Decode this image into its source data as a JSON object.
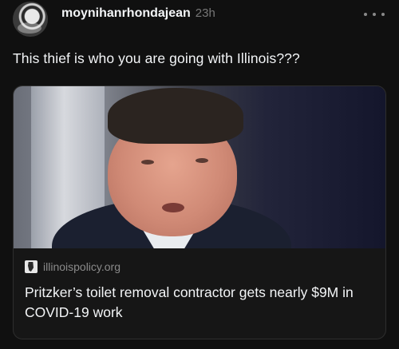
{
  "post": {
    "username": "moynihanrhondajean",
    "timestamp": "23h",
    "text": "This thief is who you are going with Illinois???",
    "more_icon": "more-horizontal-icon"
  },
  "link_card": {
    "source": "illinoispolicy.org",
    "headline": "Pritzker’s toilet removal contractor gets nearly $9M in COVID-19 work"
  }
}
